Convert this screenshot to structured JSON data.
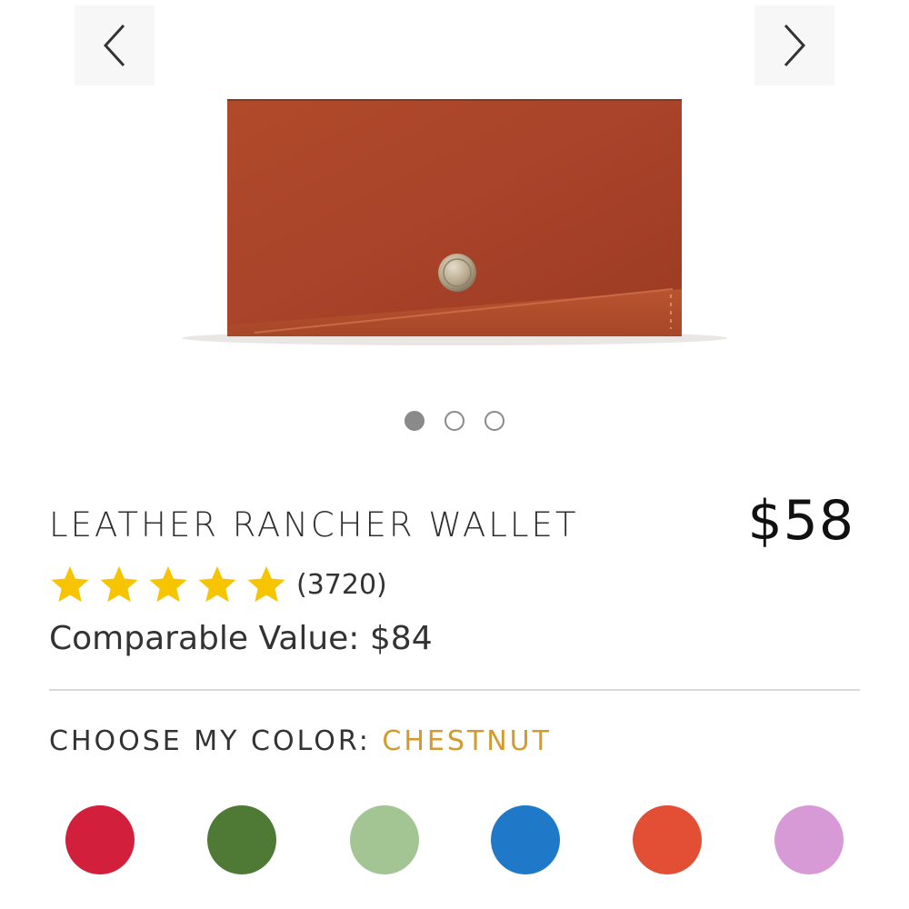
{
  "carousel": {
    "prev_icon": "chevron-left-icon",
    "next_icon": "chevron-right-icon",
    "image_alt": "Leather Rancher Wallet in Chestnut",
    "slide_count": 3,
    "active_slide": 1
  },
  "product": {
    "title": "LEATHER RANCHER WALLET",
    "price": "$58",
    "rating_stars": 5,
    "review_count": "(3720)",
    "comparable_value": "Comparable Value: $84",
    "star_color": "#f6c400"
  },
  "color_picker": {
    "label": "CHOOSE MY COLOR: ",
    "selected_name": "CHESTNUT",
    "selected_color": "#d39a2e",
    "swatches": [
      "#d21f3c",
      "#4f7a36",
      "#a3c593",
      "#1f78c8",
      "#e24f35",
      "#d79ad6"
    ]
  }
}
